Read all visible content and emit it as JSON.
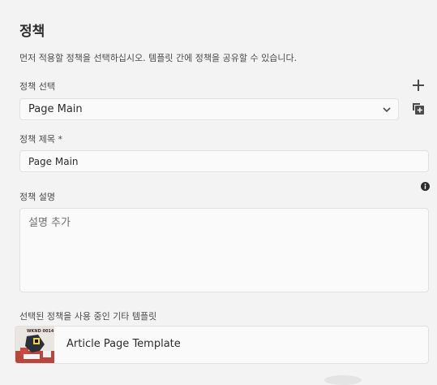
{
  "panel": {
    "title": "정책",
    "description": "먼저 적용할 정책을 선택하십시오. 템플릿 간에 정책을 공유할 수 있습니다."
  },
  "policy_select": {
    "label": "정책 선택",
    "value": "Page Main",
    "icons": [
      "plus-icon",
      "duplicate-icon",
      "chevron-down-icon"
    ]
  },
  "policy_title": {
    "label": "정책 제목 *",
    "value": "Page Main"
  },
  "policy_description": {
    "label": "정책 설명",
    "placeholder": "설명 추가",
    "icon": "info-icon"
  },
  "other_templates": {
    "label": "선택된 정책을 사용 중인 기타 템플릿",
    "items": [
      {
        "name": "Article Page Template",
        "thumb_text": "WKND 0014"
      }
    ]
  },
  "colors": {
    "background": "#f3f3f3",
    "field_background": "#fafafa",
    "field_border": "#e1e1e1",
    "text": "#2c2c2c"
  }
}
